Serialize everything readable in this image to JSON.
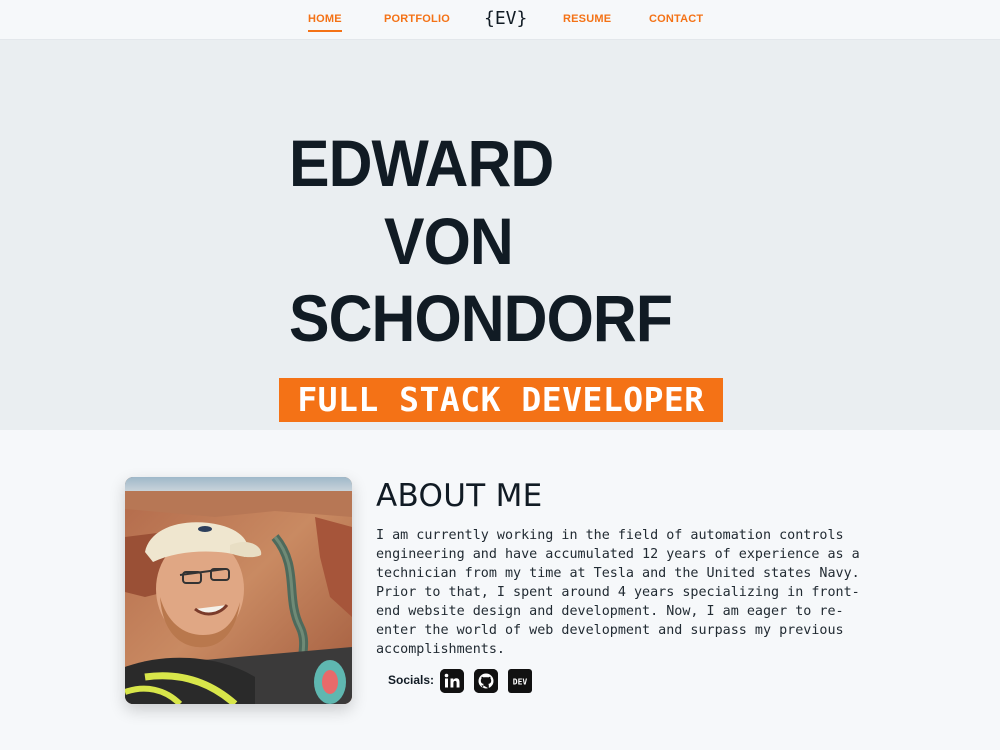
{
  "nav": {
    "home": "HOME",
    "portfolio": "PORTFOLIO",
    "logo": "{EV}",
    "resume": "RESUME",
    "contact": "CONTACT"
  },
  "hero": {
    "name_line_1": "EDWARD",
    "name_line_2": "VON",
    "name_line_3": "SCHONDORF",
    "role": "FULL STACK DEVELOPER"
  },
  "about": {
    "title": "ABOUT ME",
    "text": "I am currently working in the field of automation controls engineering and have accumulated 12 years of experience as a technician from my time at Tesla and the United states Navy. Prior to that, I spent around 4 years specializing in front-end website design and development. Now, I am eager to re-enter the world of web development and surpass my previous accomplishments.",
    "socials_label": "Socials:",
    "socials": [
      {
        "icon": "linkedin-icon"
      },
      {
        "icon": "github-icon"
      },
      {
        "icon": "dev-icon",
        "text": "DEV"
      }
    ]
  },
  "colors": {
    "accent": "#f47216",
    "dark": "#111b24",
    "hero_bg": "#eaeef1",
    "page_bg": "#f6f8fa"
  }
}
